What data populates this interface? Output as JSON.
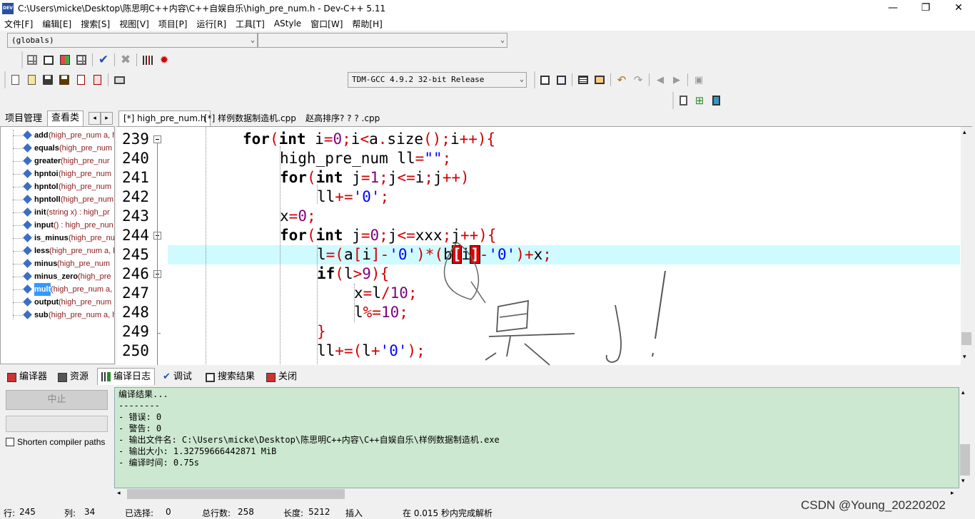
{
  "window": {
    "title": "C:\\Users\\micke\\Desktop\\陈思明C++内容\\C++自娱自乐\\high_pre_num.h - Dev-C++ 5.11",
    "app_icon_text": "DEV",
    "minimize": "—",
    "maximize": "❐",
    "close": "✕"
  },
  "menu": [
    "文件[F]",
    "编辑[E]",
    "搜索[S]",
    "视图[V]",
    "项目[P]",
    "运行[R]",
    "工具[T]",
    "AStyle",
    "窗口[W]",
    "帮助[H]"
  ],
  "scope_combo": {
    "value": "(globals)",
    "second": ""
  },
  "compiler_combo": "TDM-GCC 4.9.2 32-bit Release",
  "left_panel": {
    "tabs": [
      "项目管理",
      "查看类"
    ],
    "items": [
      {
        "name": "add",
        "sig": " (high_pre_num a, h"
      },
      {
        "name": "equals",
        "sig": " (high_pre_num"
      },
      {
        "name": "greater",
        "sig": " (high_pre_nur"
      },
      {
        "name": "hpntoi",
        "sig": " (high_pre_num"
      },
      {
        "name": "hpntol",
        "sig": " (high_pre_num"
      },
      {
        "name": "hpntoll",
        "sig": " (high_pre_num"
      },
      {
        "name": "init",
        "sig": " (string x) : high_pr"
      },
      {
        "name": "input",
        "sig": " () : high_pre_nun"
      },
      {
        "name": "is_minus",
        "sig": " (high_pre_nu"
      },
      {
        "name": "less",
        "sig": " (high_pre_num a, h"
      },
      {
        "name": "minus",
        "sig": " (high_pre_num"
      },
      {
        "name": "minus_zero",
        "sig": " (high_pre"
      },
      {
        "name": "mult",
        "sig": " (high_pre_num a,"
      },
      {
        "name": "output",
        "sig": " (high_pre_num"
      },
      {
        "name": "sub",
        "sig": " (high_pre_num a, h"
      }
    ]
  },
  "editor_tabs": [
    "[*] high_pre_num.h",
    "[*] 样例数据制造机.cpp",
    "赵高排序? ? ? .cpp"
  ],
  "code": {
    "line_numbers": [
      "239",
      "240",
      "241",
      "242",
      "243",
      "244",
      "245",
      "246",
      "247",
      "248",
      "249",
      "250"
    ],
    "current_line": "245"
  },
  "bottom_tabs": [
    "编译器",
    "资源",
    "编译日志",
    "调试",
    "搜索结果",
    "关闭"
  ],
  "abort_button": "中止",
  "shorten_label": "Shorten compiler paths",
  "log": [
    "编译结果...",
    "--------",
    "- 错误: 0",
    "- 警告: 0",
    "- 输出文件名: C:\\Users\\micke\\Desktop\\陈思明C++内容\\C++自娱自乐\\样例数据制造机.exe",
    "- 输出大小: 1.32759666442871 MiB",
    "- 编译时间: 0.75s"
  ],
  "status": {
    "row_label": "行:",
    "row": "245",
    "col_label": "列:",
    "col": "34",
    "sel_label": "已选择:",
    "sel": "0",
    "total_label": "总行数:",
    "total": "258",
    "len_label": "长度:",
    "len": "5212",
    "mode": "插入",
    "parse": "在 0.015 秒内完成解析"
  },
  "watermark": "CSDN @Young_20220202",
  "colors": {
    "accent_keyword": "#000000",
    "operator": "#d00000",
    "number": "#7f007f",
    "string": "#0000ff",
    "current_line_bg": "#cffaff",
    "log_bg": "#cde8d0"
  }
}
